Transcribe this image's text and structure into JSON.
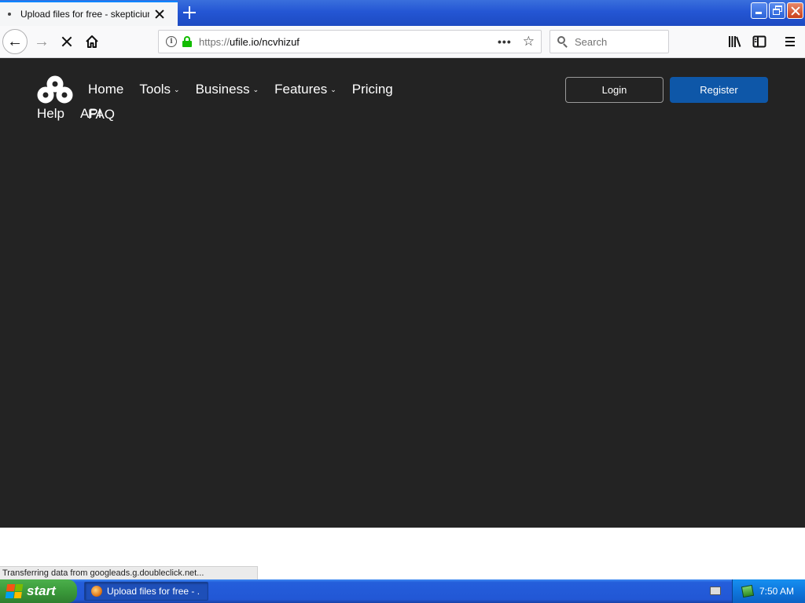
{
  "browser": {
    "tab": {
      "title": "Upload files for free - skepticium.e"
    },
    "url": {
      "protocol": "https://",
      "host_path": "ufile.io/ncvhizuf"
    },
    "search": {
      "placeholder": "Search"
    },
    "status_text": "Transferring data from googleads.g.doubleclick.net..."
  },
  "site": {
    "nav": [
      {
        "label": "Home",
        "has_dropdown": false
      },
      {
        "label": "Tools",
        "has_dropdown": true
      },
      {
        "label": "Business",
        "has_dropdown": true
      },
      {
        "label": "Features",
        "has_dropdown": true
      },
      {
        "label": "Pricing",
        "has_dropdown": false
      },
      {
        "label": "FAQ",
        "has_dropdown": false
      }
    ],
    "nav_row2": [
      "Help",
      "API"
    ],
    "login_label": "Login",
    "register_label": "Register",
    "dropdown_glyph": "⌄"
  },
  "taskbar": {
    "start_label": "start",
    "task_label": "Upload files for free - ...",
    "clock": "7:50 AM"
  },
  "colors": {
    "page_bg": "#232323",
    "register_bg": "#0e57a8",
    "lock_green": "#12bc00"
  },
  "icons": [
    "bullet-dot-icon",
    "close-icon",
    "plus-icon",
    "back-arrow-icon",
    "forward-arrow-icon",
    "stop-icon",
    "home-icon",
    "info-icon",
    "lock-icon",
    "more-dots-icon",
    "star-icon",
    "search-icon",
    "library-icon",
    "sidebar-icon",
    "hamburger-icon",
    "ufile-logo",
    "chevron-down-icon",
    "windows-flag-icon",
    "keyboard-icon",
    "network-icon"
  ]
}
